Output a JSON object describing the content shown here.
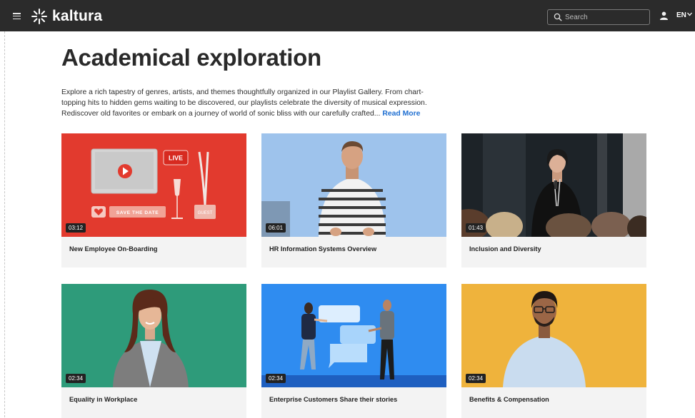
{
  "header": {
    "brand": "kaltura",
    "search_placeholder": "Search",
    "language": "EN"
  },
  "page": {
    "title": "Academical exploration",
    "description": "Explore a rich tapestry of genres, artists, and themes thoughtfully organized in our Playlist Gallery. From chart-topping hits to hidden gems waiting to be discovered, our playlists celebrate the diversity of musical expression. Rediscover old favorites or embark on a journey of world of sonic bliss with our carefully crafted...",
    "read_more": "Read More"
  },
  "cards": [
    {
      "title": "New Employee On-Boarding",
      "duration": "03:12"
    },
    {
      "title": "HR Information Systems Overview",
      "duration": "06:01"
    },
    {
      "title": "Inclusion and Diversity",
      "duration": "01:43"
    },
    {
      "title": "Equality in Workplace",
      "duration": "02:34"
    },
    {
      "title": "Enterprise Customers Share their stories",
      "duration": "02:34"
    },
    {
      "title": "Benefits & Compensation",
      "duration": "02:34"
    }
  ],
  "thumb_text": {
    "live": "LIVE",
    "save_the_date": "SAVE THE DATE",
    "guest": "GUEST"
  },
  "colors": {
    "topbar": "#2b2b2b",
    "accent_link": "#1f6fd1",
    "card_bg": "#f3f3f3"
  },
  "icons": [
    "hamburger-icon",
    "kaltura-logo-icon",
    "search-icon",
    "user-icon",
    "chevron-down-icon",
    "play-icon",
    "heart-icon"
  ]
}
